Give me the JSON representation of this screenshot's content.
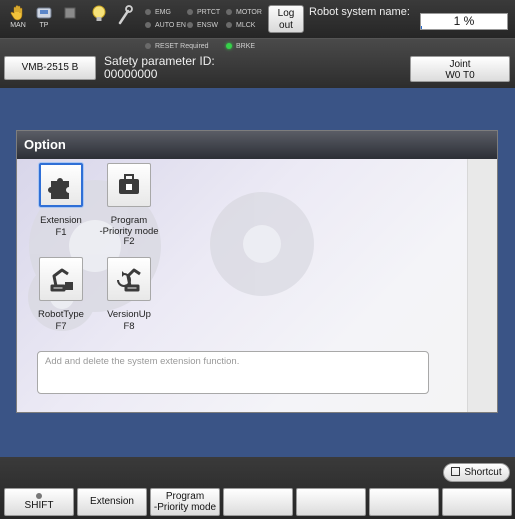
{
  "topbar": {
    "mode_label": "MAN",
    "tp_label": "TP",
    "logout_line1": "Log",
    "logout_line2": "out",
    "robot_system_name_label": "Robot system name:",
    "speed": "1 %",
    "speed_fraction": 0.01,
    "indicators": {
      "emg": "EMG",
      "prtct": "PRTCT",
      "motor": "MOTOR",
      "auto_en": "AUTO EN",
      "ensw": "ENSW",
      "mlck": "MLCK",
      "reset_required": "RESET Required",
      "brke": "BRKE"
    }
  },
  "header2": {
    "robot_model": "VMB-2515 B",
    "safety_param_label": "Safety parameter ID:",
    "safety_param_id": "00000000",
    "joint_line1": "Joint",
    "joint_line2": "W0 T0"
  },
  "panel": {
    "title": "Option",
    "options": [
      {
        "name": "Extension",
        "key": "F1",
        "icon": "puzzle-icon"
      },
      {
        "name": "Program\n-Priority mode",
        "key": "F2",
        "icon": "toolbox-lock-icon"
      },
      {
        "name": "RobotType",
        "key": "F7",
        "icon": "robot-arm-lock-icon"
      },
      {
        "name": "VersionUp",
        "key": "F8",
        "icon": "robot-arm-update-icon"
      }
    ],
    "description": "Add and delete the system extension function."
  },
  "bottom": {
    "shortcut": "Shortcut",
    "shift": "SHIFT",
    "f1": "Extension",
    "f2_line1": "Program",
    "f2_line2": "-Priority mode"
  },
  "colors": {
    "main_bg": "#3a5486",
    "selected_border": "#2f6fd6",
    "brke_led": "#36d24a"
  }
}
